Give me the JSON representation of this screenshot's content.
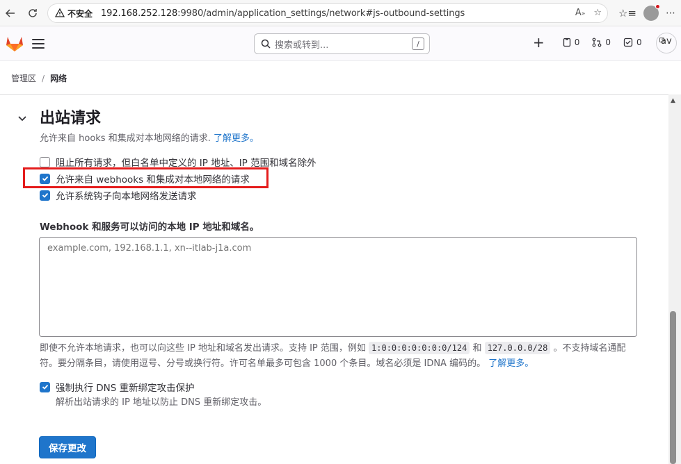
{
  "browser": {
    "insecure_label": "不安全",
    "url_host": "192.168.252.128",
    "url_rest": ":9980/admin/application_settings/network#js-outbound-settings"
  },
  "header": {
    "search_placeholder": "搜索或转到...",
    "search_shortcut": "/",
    "issues_count": "0",
    "merge_requests_count": "0",
    "todos_count": "0",
    "avatar_alt": "av"
  },
  "breadcrumb": {
    "items": [
      "管理区",
      "网络"
    ],
    "separator": "/"
  },
  "section": {
    "title": "出站请求",
    "description": "允许来自 hooks 和集成对本地网络的请求.",
    "learn_more": "了解更多。",
    "checkboxes": [
      {
        "label": "阻止所有请求，但白名单中定义的 IP 地址、IP 范围和域名除外",
        "checked": false
      },
      {
        "label": "允许来自 webhooks 和集成对本地网络的请求",
        "checked": true
      },
      {
        "label": "允许系统钩子向本地网络发送请求",
        "checked": true
      }
    ],
    "allowlist_label": "Webhook 和服务可以访问的本地 IP 地址和域名。",
    "allowlist_placeholder": "example.com, 192.168.1.1, xn--itlab-j1a.com",
    "help_part1": "即使不允许本地请求，也可以向这些 IP 地址和域名发出请求。支持 IP 范围，例如",
    "help_code1": "1:0:0:0:0:0:0:0/124",
    "help_and": "和",
    "help_code2": "127.0.0.0/28",
    "help_part2": "。不支持域名通配符。要分隔条目，请使用逗号、分号或换行符。许可名单最多可包含 1000 个条目。域名必须是 IDNA 编码的。",
    "help_learn_more": "了解更多。",
    "dns_label": "强制执行 DNS 重新绑定攻击保护",
    "dns_checked": true,
    "dns_description": "解析出站请求的 IP 地址以防止 DNS 重新绑定攻击。",
    "save_label": "保存更改"
  },
  "colors": {
    "accent": "#1f75cb",
    "highlight_border": "#e41c1c"
  }
}
